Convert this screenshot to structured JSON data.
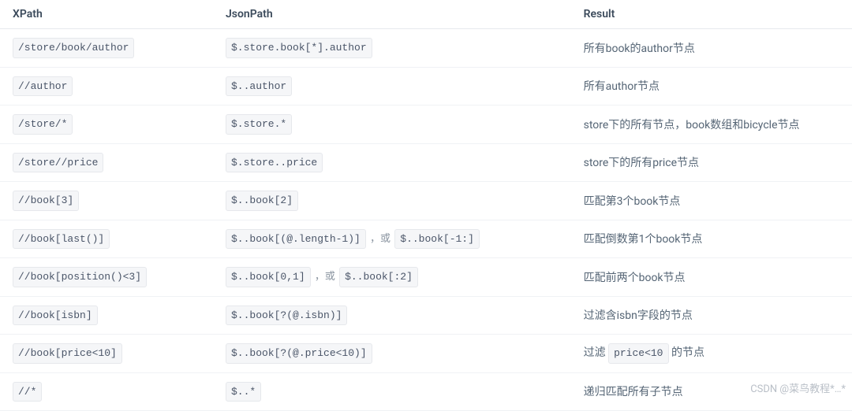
{
  "table": {
    "headers": [
      "XPath",
      "JsonPath",
      "Result"
    ],
    "rows": [
      {
        "xpath": "/store/book/author",
        "jsonpath": [
          {
            "t": "code",
            "v": "$.store.book[*].author"
          }
        ],
        "result": [
          {
            "t": "text",
            "v": "所有book的author节点"
          }
        ]
      },
      {
        "xpath": "//author",
        "jsonpath": [
          {
            "t": "code",
            "v": "$..author"
          }
        ],
        "result": [
          {
            "t": "text",
            "v": "所有author节点"
          }
        ]
      },
      {
        "xpath": "/store/*",
        "jsonpath": [
          {
            "t": "code",
            "v": "$.store.*"
          }
        ],
        "result": [
          {
            "t": "text",
            "v": "store下的所有节点，book数组和bicycle节点"
          }
        ]
      },
      {
        "xpath": "/store//price",
        "jsonpath": [
          {
            "t": "code",
            "v": "$.store..price"
          }
        ],
        "result": [
          {
            "t": "text",
            "v": "store下的所有price节点"
          }
        ]
      },
      {
        "xpath": "//book[3]",
        "jsonpath": [
          {
            "t": "code",
            "v": "$..book[2]"
          }
        ],
        "result": [
          {
            "t": "text",
            "v": "匹配第3个book节点"
          }
        ]
      },
      {
        "xpath": "//book[last()]",
        "jsonpath": [
          {
            "t": "code",
            "v": "$..book[(@.length-1)]"
          },
          {
            "t": "sep",
            "v": " ，或 "
          },
          {
            "t": "code",
            "v": "$..book[-1:]"
          }
        ],
        "result": [
          {
            "t": "text",
            "v": "匹配倒数第1个book节点"
          }
        ]
      },
      {
        "xpath": "//book[position()<3]",
        "jsonpath": [
          {
            "t": "code",
            "v": "$..book[0,1]"
          },
          {
            "t": "sep",
            "v": " ，或 "
          },
          {
            "t": "code",
            "v": "$..book[:2]"
          }
        ],
        "result": [
          {
            "t": "text",
            "v": "匹配前两个book节点"
          }
        ]
      },
      {
        "xpath": "//book[isbn]",
        "jsonpath": [
          {
            "t": "code",
            "v": "$..book[?(@.isbn)]"
          }
        ],
        "result": [
          {
            "t": "text",
            "v": "过滤含isbn字段的节点"
          }
        ]
      },
      {
        "xpath": "//book[price<10]",
        "jsonpath": [
          {
            "t": "code",
            "v": "$..book[?(@.price<10)]"
          }
        ],
        "result": [
          {
            "t": "text",
            "v": "过滤 "
          },
          {
            "t": "code",
            "v": "price<10"
          },
          {
            "t": "text",
            "v": " 的节点"
          }
        ]
      },
      {
        "xpath": "//*",
        "jsonpath": [
          {
            "t": "code",
            "v": "$..*"
          }
        ],
        "result": [
          {
            "t": "text",
            "v": "递归匹配所有子节点"
          }
        ]
      }
    ]
  },
  "watermark": "CSDN @菜鸟教程*…*"
}
